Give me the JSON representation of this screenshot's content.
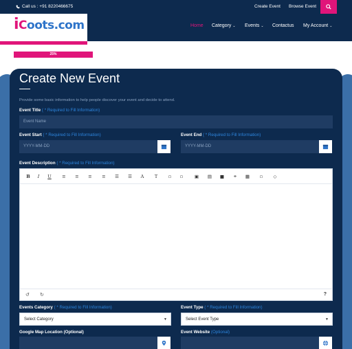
{
  "topbar": {
    "phone": "Call us : +91 8220466675",
    "create_event": "Create Event",
    "browse_event": "Browse Event"
  },
  "logo": {
    "text_i": "i",
    "text_c": "C",
    "text_rest": "oots.com"
  },
  "nav": {
    "home": "Home",
    "category": "Category",
    "events": "Events",
    "contactus": "Contactus",
    "my_account": "My Account"
  },
  "progress": {
    "value_percent": 25,
    "label": "25%"
  },
  "form": {
    "title": "Create New Event",
    "description": "Provide some basic information to help people discover your event and decide to attend.",
    "required_note": "( * Required to Fill Information)",
    "event_title": {
      "label": "Event Title",
      "placeholder": "Event Name"
    },
    "event_start": {
      "label": "Event Start",
      "placeholder": "YYYY-MM-DD"
    },
    "event_end": {
      "label": "Event End",
      "placeholder": "YYYY-MM-DD"
    },
    "event_description": {
      "label": "Event Description"
    },
    "events_category": {
      "label": "Events Category",
      "value": "Select Category"
    },
    "event_type": {
      "label": "Event Type",
      "value": "Select Event Type"
    },
    "google_map": {
      "label": "Google Map Location (Optional)"
    },
    "event_website": {
      "label": "Event Website",
      "optional": "(Optional)"
    }
  },
  "editor_toolbar": [
    {
      "name": "bold-button",
      "glyph": "B"
    },
    {
      "name": "italic-button",
      "glyph": "I"
    },
    {
      "name": "underline-button",
      "glyph": "U"
    },
    {
      "name": "align-left-button",
      "glyph": "≡"
    },
    {
      "name": "align-center-button",
      "glyph": "≡"
    },
    {
      "name": "align-right-button",
      "glyph": "≡"
    },
    {
      "name": "align-justify-button",
      "glyph": "≡"
    },
    {
      "name": "ordered-list-button",
      "glyph": "☰"
    },
    {
      "name": "unordered-list-button",
      "glyph": "☰"
    },
    {
      "name": "font-button",
      "glyph": "A"
    },
    {
      "name": "text-size-button",
      "glyph": "T"
    },
    {
      "name": "indent-button",
      "glyph": "▫"
    },
    {
      "name": "outdent-button",
      "glyph": "▫"
    },
    {
      "name": "image-button",
      "glyph": "▣"
    },
    {
      "name": "file-button",
      "glyph": "▤"
    },
    {
      "name": "video-button",
      "glyph": "■"
    },
    {
      "name": "link-button",
      "glyph": "⚭"
    },
    {
      "name": "table-button",
      "glyph": "▦"
    },
    {
      "name": "horizontal-rule-button",
      "glyph": "▫"
    },
    {
      "name": "code-view-button",
      "glyph": "◇"
    }
  ],
  "colors": {
    "navy": "#0d2a4e",
    "accent_pink": "#e0157a",
    "link_blue": "#2e86de",
    "input_bg": "#1f3c63"
  }
}
